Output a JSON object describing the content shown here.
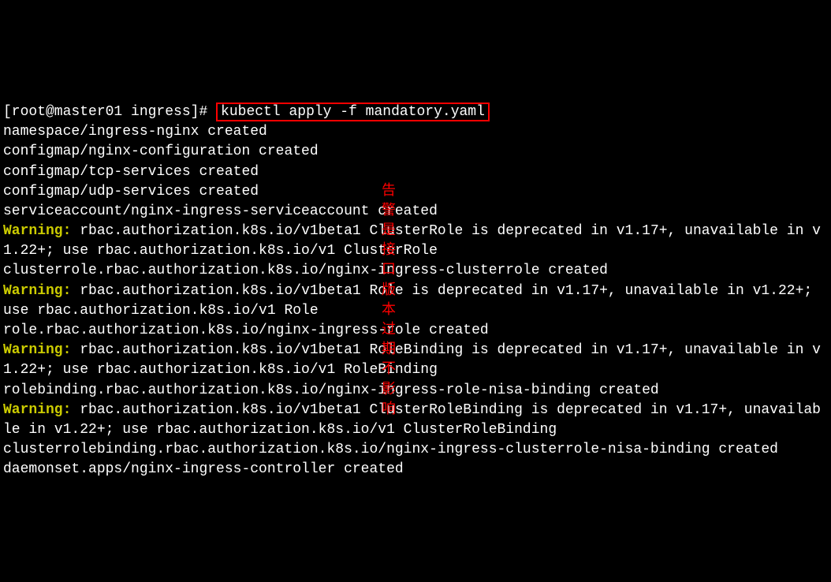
{
  "prompt": "[root@master01 ingress]# ",
  "command": "kubectl apply -f mandatory.yaml",
  "annotation": "告警是接口版本过期不影响",
  "lines": [
    "namespace/ingress-nginx created",
    "configmap/nginx-configuration created",
    "configmap/tcp-services created",
    "configmap/udp-services created",
    "serviceaccount/nginx-ingress-serviceaccount created"
  ],
  "warning1_label": "Warning:",
  "warning1_text": " rbac.authorization.k8s.io/v1beta1 ClusterRole is deprecated in v1.17+, unavailable in v1.22+; use rbac.authorization.k8s.io/v1 ClusterRole",
  "line_after_w1": "clusterrole.rbac.authorization.k8s.io/nginx-ingress-clusterrole created",
  "warning2_label": "Warning:",
  "warning2_text": " rbac.authorization.k8s.io/v1beta1 Role is deprecated in v1.17+, unavailable in v1.22+; use rbac.authorization.k8s.io/v1 Role",
  "line_after_w2": "role.rbac.authorization.k8s.io/nginx-ingress-role created",
  "warning3_label": "Warning:",
  "warning3_text": " rbac.authorization.k8s.io/v1beta1 RoleBinding is deprecated in v1.17+, unavailable in v1.22+; use rbac.authorization.k8s.io/v1 RoleBinding",
  "line_after_w3": "rolebinding.rbac.authorization.k8s.io/nginx-ingress-role-nisa-binding created",
  "warning4_label": "Warning:",
  "warning4_text": " rbac.authorization.k8s.io/v1beta1 ClusterRoleBinding is deprecated in v1.17+, unavailable in v1.22+; use rbac.authorization.k8s.io/v1 ClusterRoleBinding",
  "line_after_w4": "clusterrolebinding.rbac.authorization.k8s.io/nginx-ingress-clusterrole-nisa-binding created",
  "final_line": "daemonset.apps/nginx-ingress-controller created"
}
